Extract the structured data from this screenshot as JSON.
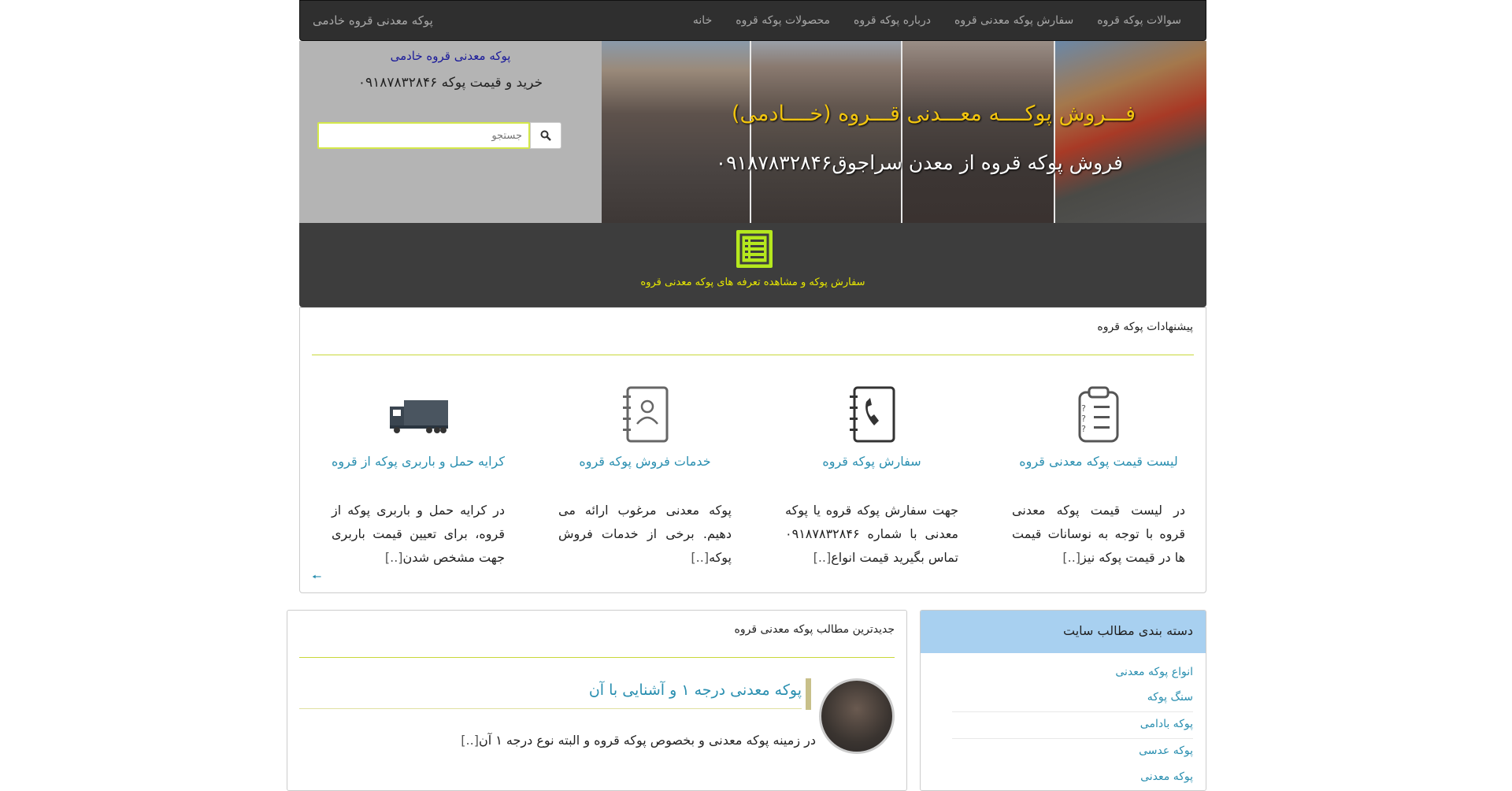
{
  "navbar": {
    "brand": "پوکه معدنی قروه خادمی",
    "items": [
      {
        "label": "سوالات پوکه قروه"
      },
      {
        "label": "سفارش پوکه معدنی قروه"
      },
      {
        "label": "درباره پوکه قروه"
      },
      {
        "label": "محصولات پوکه قروه"
      },
      {
        "label": "خانه"
      }
    ]
  },
  "header": {
    "side_title": "پوکه معدنی قروه خادمی",
    "side_subtitle": "خرید و قیمت پوکه ۰۹۱۸۷۸۳۲۸۴۶",
    "search_placeholder": "جستجو",
    "banner_title": "فـــروش پوکــــه معـــدنی قـــروه (خــــادمی)",
    "banner_subtitle": "فروش پوکه قروه از معدن سراجوق۰۹۱۸۷۸۳۲۸۴۶"
  },
  "order_bar": {
    "label": "سفارش پوکه و مشاهده تعرفه های پوکه معدنی قروه"
  },
  "suggestions": {
    "title": "پیشنهادات پوکه قروه",
    "cards": [
      {
        "icon": "clipboard-checklist-icon",
        "title": "لیست قیمت پوکه معدنی قروه",
        "text": "در لیست قیمت پوکه معدنی قروه با توجه به نوسانات قیمت ها در قیمت پوکه نیز",
        "more": "[..]"
      },
      {
        "icon": "phone-book-icon",
        "title": "سفارش پوکه قروه",
        "text": "جهت سفارش پوکه قروه یا پوکه معدنی با شماره ۰۹۱۸۷۸۳۲۸۴۶ تماس بگیرید قیمت انواع",
        "more": "[..]"
      },
      {
        "icon": "contact-book-icon",
        "title": "خدمات فروش پوکه قروه",
        "text": "پوکه معدنی مرغوب ارائه می دهیم. برخی از خدمات فروش پوکه",
        "more": "[..]"
      },
      {
        "icon": "truck-icon",
        "title": "کرایه حمل و باربری پوکه از قروه",
        "text": "در کرایه حمل و باربری پوکه از قروه، برای تعیین قیمت باربری جهت مشخص شدن",
        "more": "[..]"
      }
    ]
  },
  "latest": {
    "title": "جدیدترین مطالب پوکه معدنی قروه",
    "post_title": "پوکه معدنی درجه ۱ و آشنایی با آن",
    "post_excerpt": "در زمینه پوکه معدنی و بخصوص پوکه قروه و البته نوع درجه ۱ آن",
    "post_more": "[..]"
  },
  "categories": {
    "title": "دسته بندی مطالب سایت",
    "items": [
      {
        "label": "انواع پوکه معدنی"
      },
      {
        "label": "سنگ پوکه"
      },
      {
        "label": "پوکه بادامی"
      },
      {
        "label": "پوکه عدسی"
      },
      {
        "label": "پوکه معدنی"
      }
    ]
  },
  "colors": {
    "navbar": "#2f2f2f",
    "accent_yellow": "#f1c40f",
    "link_blue": "#2a8fb0",
    "order_icon_green": "#b5e81e",
    "category_header": "#a8d0f0"
  }
}
